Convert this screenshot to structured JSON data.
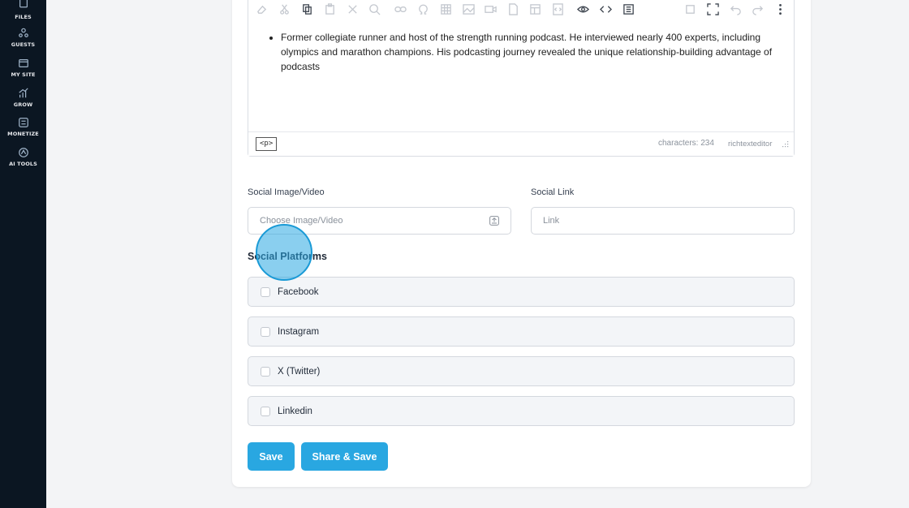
{
  "sidebar": {
    "items": [
      {
        "label": "FILES",
        "icon": "files-icon"
      },
      {
        "label": "GUESTS",
        "icon": "guests-icon"
      },
      {
        "label": "MY SITE",
        "icon": "my-site-icon"
      },
      {
        "label": "GROW",
        "icon": "grow-icon"
      },
      {
        "label": "MONETIZE",
        "icon": "monetize-icon"
      },
      {
        "label": "AI TOOLS",
        "icon": "ai-tools-icon"
      }
    ]
  },
  "editor": {
    "bullet": "Former collegiate runner and host of the strength running podcast. He interviewed nearly 400 experts, including olympics and marathon champions. His podcasting journey revealed the unique relationship-building advantage of podcasts",
    "tag": "<p>",
    "char_count": "characters: 234",
    "brand": "richtexteditor"
  },
  "form": {
    "social_image_label": "Social Image/Video",
    "social_image_placeholder": "Choose Image/Video",
    "social_link_label": "Social Link",
    "social_link_placeholder": "Link",
    "platforms_title": "Social Platforms",
    "platforms": [
      {
        "label": "Facebook",
        "checked": false
      },
      {
        "label": "Instagram",
        "checked": false
      },
      {
        "label": "X (Twitter)",
        "checked": false
      },
      {
        "label": "Linkedin",
        "checked": false
      }
    ]
  },
  "actions": {
    "save_label": "Save",
    "share_save_label": "Share & Save"
  },
  "colors": {
    "accent": "#29a7e1",
    "sidebar_bg": "#0b1622",
    "page_bg": "#f3f4f6"
  }
}
